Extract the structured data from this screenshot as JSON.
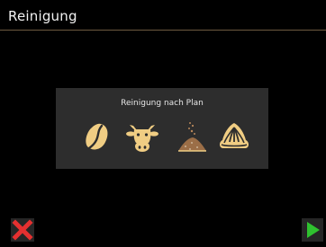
{
  "header": {
    "title": "Reinigung"
  },
  "panel": {
    "title": "Reinigung nach Plan",
    "icons": [
      "coffee-bean-icon",
      "cow-milk-icon",
      "cleaning-powder-icon",
      "milk-foam-icon"
    ]
  },
  "colors": {
    "background": "#000000",
    "panel": "#2d2d2d",
    "accent": "#f0cd83",
    "cancel": "#e53030",
    "confirm": "#2fc12f",
    "divider": "#6e5a40"
  },
  "footer": {
    "cancel_icon": "close-icon",
    "next_icon": "play-arrow-icon"
  }
}
